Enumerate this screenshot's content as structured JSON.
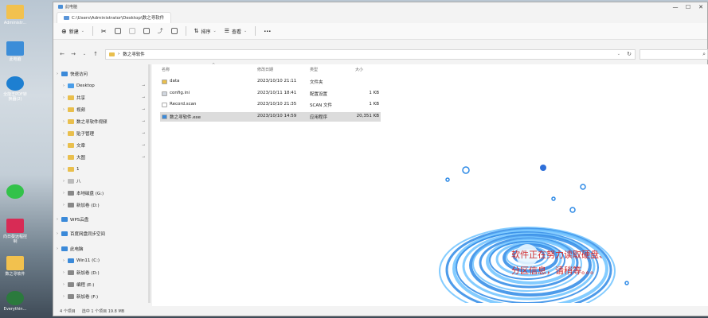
{
  "desktop": {
    "icons": [
      {
        "label": "Administr..."
      },
      {
        "label": "此电脑"
      },
      {
        "label": "全能王PDF转换器(2)"
      },
      {
        "label": ""
      },
      {
        "label": "向日葵远程控制"
      },
      {
        "label": "数之寻软件"
      },
      {
        "label": "Everythin..."
      }
    ]
  },
  "window": {
    "title": "此电脑",
    "tab_title": "C:\\Users\\Administrator\\Desktop\\数之寻软件",
    "controls": {
      "minimize": "—",
      "maximize": "☐",
      "close": "✕"
    }
  },
  "toolbar": {
    "new_label": "新建",
    "sort_label": "排序",
    "view_label": "查看",
    "more_label": "···"
  },
  "address": {
    "path_root": "›",
    "path": "数之寻软件",
    "search_placeholder": ""
  },
  "sidebar": {
    "items": [
      {
        "label": "快速访问",
        "pinned": false,
        "color": "#3b8ad9"
      },
      {
        "label": "Desktop",
        "pinned": true,
        "color": "#4a9de8"
      },
      {
        "label": "共享",
        "pinned": true,
        "color": "#e9bf4d"
      },
      {
        "label": "视频",
        "pinned": true,
        "color": "#e9bf4d"
      },
      {
        "label": "数之寻软件视频",
        "pinned": true,
        "color": "#e9bf4d"
      },
      {
        "label": "贴子管理",
        "pinned": true,
        "color": "#e9bf4d"
      },
      {
        "label": "文章",
        "pinned": true,
        "color": "#e9bf4d"
      },
      {
        "label": "大图",
        "pinned": true,
        "color": "#e9bf4d"
      },
      {
        "label": "1",
        "pinned": false,
        "color": "#e9bf4d"
      },
      {
        "label": "八",
        "pinned": false,
        "color": "#bbbbbb"
      },
      {
        "label": "本地磁盘 (G:)",
        "pinned": false,
        "color": "#888888"
      },
      {
        "label": "新加卷 (D:)",
        "pinned": false,
        "color": "#888888"
      },
      {
        "label": "WPS云盘",
        "pinned": false,
        "color": "#3b8ad9"
      },
      {
        "label": "百度网盘同步空间",
        "pinned": false,
        "color": "#3b8ad9"
      },
      {
        "label": "此电脑",
        "pinned": false,
        "color": "#3b8ad9"
      },
      {
        "label": "Win11 (C:)",
        "pinned": false,
        "color": "#3b8ad9"
      },
      {
        "label": "新加卷 (D:)",
        "pinned": false,
        "color": "#888888"
      },
      {
        "label": "编程 (E:)",
        "pinned": false,
        "color": "#888888"
      },
      {
        "label": "新加卷 (F:)",
        "pinned": false,
        "color": "#888888"
      },
      {
        "label": "本地磁盘 (G:)",
        "pinned": false,
        "color": "#888888"
      }
    ]
  },
  "columns": {
    "name": "名称",
    "date": "修改日期",
    "type": "类型",
    "size": "大小"
  },
  "files": [
    {
      "name": "data",
      "date": "2023/10/10 21:11",
      "type": "文件夹",
      "size": "",
      "color": "#e9bf4d"
    },
    {
      "name": "config.ini",
      "date": "2023/10/11 18:41",
      "type": "配置设置",
      "size": "1 KB",
      "color": "#d0d6de"
    },
    {
      "name": "Record.scan",
      "date": "2023/10/10 21:35",
      "type": "SCAN 文件",
      "size": "1 KB",
      "color": "#ffffff"
    },
    {
      "name": "数之寻软件.exe",
      "date": "2023/10/10 14:59",
      "type": "应用程序",
      "size": "20,351 KB",
      "color": "#3b8ad9"
    }
  ],
  "status": {
    "count": "4 个项目",
    "selected": "选中 1 个项目 19.8 MB"
  },
  "loading": {
    "line1": "软件正在努力读取硬盘、",
    "line2": "分区信息，请稍等。。。"
  }
}
